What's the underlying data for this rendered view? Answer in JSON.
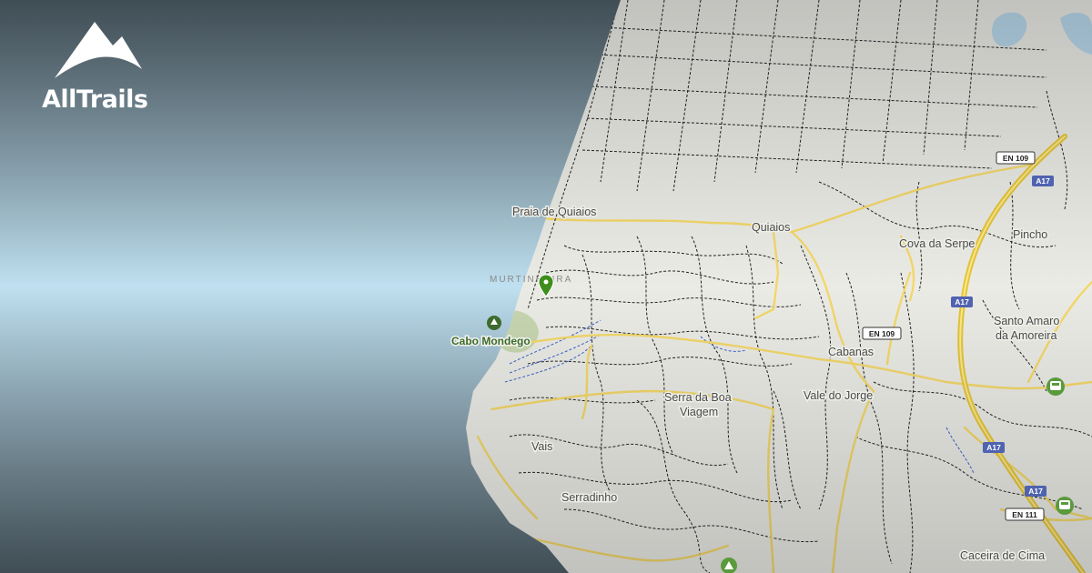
{
  "brand": {
    "name": "AllTrails",
    "logo_icon": "mountain-logo-icon"
  },
  "map": {
    "places": [
      {
        "id": "praia-de-quiaios",
        "label": "Praia de Quiaios"
      },
      {
        "id": "quiaios",
        "label": "Quiaios"
      },
      {
        "id": "cova-da-serpe",
        "label": "Cova da Serpe"
      },
      {
        "id": "pincho",
        "label": "Pincho"
      },
      {
        "id": "murtinheira",
        "label": "MURTINHEIRA"
      },
      {
        "id": "santo-amaro-1",
        "label": "Santo Amaro"
      },
      {
        "id": "santo-amaro-2",
        "label": "da Amoreira"
      },
      {
        "id": "cabanas",
        "label": "Cabanas"
      },
      {
        "id": "serra-1",
        "label": "Serra da Boa"
      },
      {
        "id": "serra-2",
        "label": "Viagem"
      },
      {
        "id": "vale-do-jorge",
        "label": "Vale do Jorge"
      },
      {
        "id": "vais",
        "label": "Vais"
      },
      {
        "id": "serradinho",
        "label": "Serradinho"
      },
      {
        "id": "caceira",
        "label": "Caceira de Cima"
      }
    ],
    "poi": {
      "label": "Cabo Mondego",
      "icon": "park-icon"
    },
    "trail_marker": {
      "icon": "map-pin-icon",
      "color": "#3e8e1b"
    },
    "road_shields": {
      "en109_top": "EN 109",
      "en109_mid": "EN 109",
      "en111": "EN 111",
      "a17_1": "A17",
      "a17_2": "A17",
      "a17_3": "A17",
      "a17_4": "A17"
    },
    "transit_icons": [
      "train-icon",
      "train-icon"
    ],
    "colors": {
      "land": "#ececE8",
      "road": "#f3d86a",
      "motorway": "#e5c53a",
      "trail": "#222222",
      "water_trail": "#3b63c8",
      "park": "#c7d6b0",
      "shield_blue": "#4f63b0",
      "marker_green": "#3e8e1b",
      "transit_green": "#5a9a3c"
    }
  }
}
